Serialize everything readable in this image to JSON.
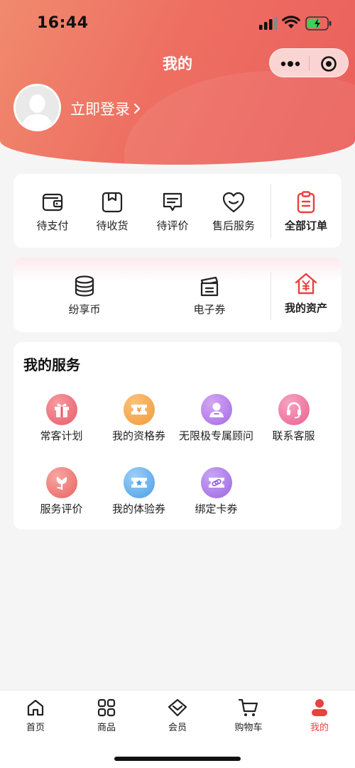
{
  "status_bar": {
    "time": "16:44"
  },
  "nav": {
    "title": "我的"
  },
  "user": {
    "login_label": "立即登录"
  },
  "orders": {
    "items": [
      {
        "label": "待支付",
        "icon": "wallet-icon"
      },
      {
        "label": "待收货",
        "icon": "package-icon"
      },
      {
        "label": "待评价",
        "icon": "comment-icon"
      },
      {
        "label": "售后服务",
        "icon": "heart-icon"
      }
    ],
    "all_label": "全部订单"
  },
  "assets": {
    "items": [
      {
        "label": "纷享币",
        "icon": "coins-icon"
      },
      {
        "label": "电子券",
        "icon": "ticket-icon"
      }
    ],
    "mine_label": "我的资产"
  },
  "services": {
    "title": "我的服务",
    "items": [
      {
        "label": "常客计划",
        "icon": "gift-icon",
        "color": "#ee6a73"
      },
      {
        "label": "我的资格券",
        "icon": "coupon-icon",
        "color": "#f4a64a"
      },
      {
        "label": "无限极专属顾问",
        "icon": "advisor-icon",
        "color": "#b07ae8"
      },
      {
        "label": "联系客服",
        "icon": "headset-icon",
        "color": "#ef6f9c"
      },
      {
        "label": "服务评价",
        "icon": "flower-icon",
        "color": "#ef7a7a"
      },
      {
        "label": "我的体验券",
        "icon": "star-ticket-icon",
        "color": "#55a9ee"
      },
      {
        "label": "绑定卡券",
        "icon": "link-icon",
        "color": "#a877e6"
      }
    ]
  },
  "tabbar": {
    "items": [
      {
        "label": "首页",
        "icon": "home-icon"
      },
      {
        "label": "商品",
        "icon": "grid-icon"
      },
      {
        "label": "会员",
        "icon": "diamond-icon"
      },
      {
        "label": "购物车",
        "icon": "cart-icon"
      },
      {
        "label": "我的",
        "icon": "person-icon"
      }
    ],
    "active_color": "#e8413e"
  }
}
